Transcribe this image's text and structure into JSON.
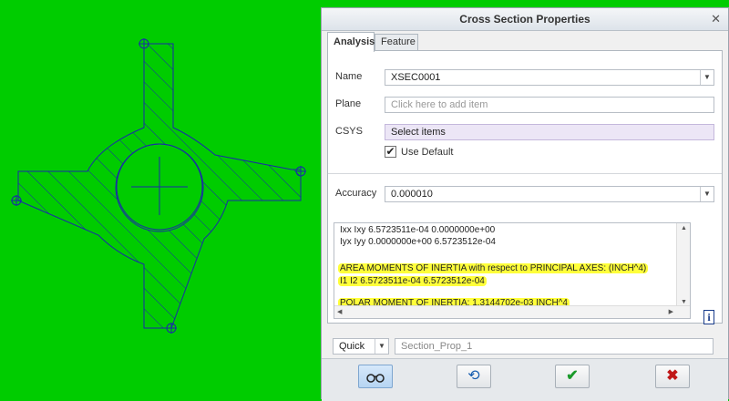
{
  "dialog": {
    "title": "Cross Section Properties",
    "close_icon": "close-x",
    "tabs": [
      {
        "label": "Analysis",
        "active": true
      },
      {
        "label": "Feature",
        "active": false
      }
    ]
  },
  "form": {
    "name_label": "Name",
    "name_value": "XSEC0001",
    "plane_label": "Plane",
    "plane_placeholder": "Click here to add item",
    "csys_label": "CSYS",
    "csys_value": "Select items",
    "use_default_label": "Use Default",
    "use_default_checked": true,
    "accuracy_label": "Accuracy",
    "accuracy_value": "0.000010"
  },
  "results": {
    "lines": [
      "Ixx Ixy  6.5723511e-04  0.0000000e+00",
      "Iyx Iyy  0.0000000e+00  6.5723512e-04",
      "",
      "AREA MOMENTS OF INERTIA with respect to PRINCIPAL AXES:  (INCH^4)",
      "I1  I2  6.5723511e-04  6.5723512e-04",
      "",
      "POLAR MOMENT OF INERTIA:  1.3144702e-03 INCH^4"
    ],
    "highlighted": [
      false,
      false,
      false,
      true,
      true,
      false,
      true
    ]
  },
  "bottom": {
    "mode_value": "Quick",
    "section_name_placeholder": "Section_Prop_1"
  },
  "buttons": {
    "preview_icon": "glasses-icon",
    "repaint_icon": "refresh-icon",
    "ok_icon": "checkmark-icon",
    "cancel_icon": "x-icon"
  },
  "colors": {
    "background": "#00cc00",
    "sketch_line": "#1a2aa8",
    "highlight": "#ffff3a"
  }
}
